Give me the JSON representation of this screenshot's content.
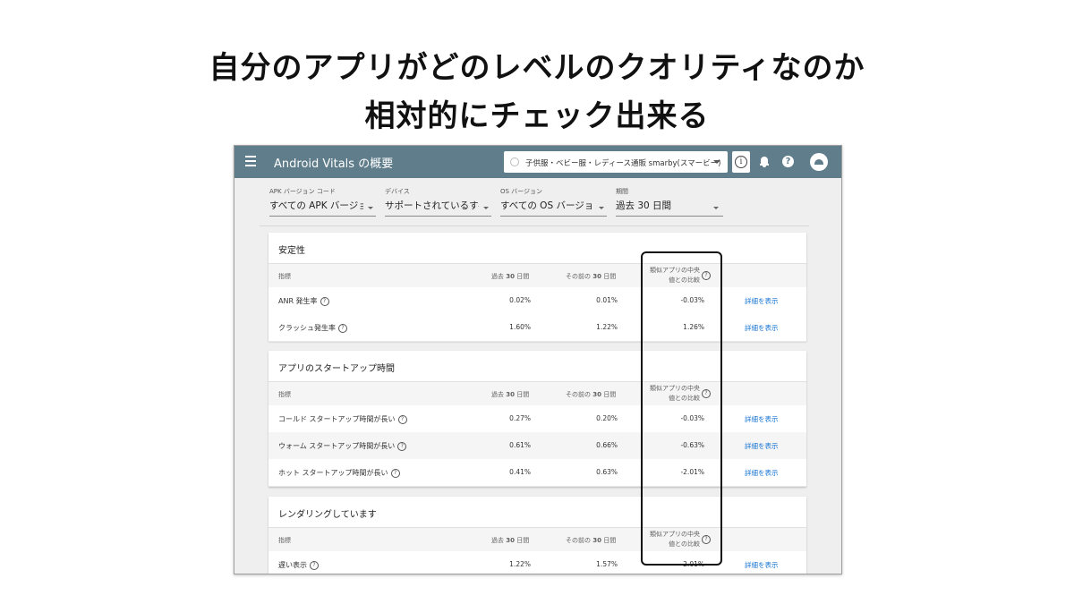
{
  "headline": {
    "line1": "自分のアプリがどのレベルのクオリティなのか",
    "line2": "相対的にチェック出来る"
  },
  "appbar": {
    "title": "Android Vitals の概要",
    "app_selector": "子供服・ベビー服・レディース通販 smarby(スマービー)",
    "info_glyph": "i",
    "help_glyph": "?",
    "colors": {
      "bar": "#607d8b"
    }
  },
  "filters": [
    {
      "label": "APK バージョン コード",
      "value": "すべての APK バージョ"
    },
    {
      "label": "デバイス",
      "value": "サポートされているすべ"
    },
    {
      "label": "OS バージョン",
      "value": "すべての OS バージョン"
    },
    {
      "label": "期間",
      "value": "過去 30 日間"
    }
  ],
  "columns": {
    "metric": "指標",
    "last30_prefix": "過去",
    "last30_num": "30",
    "last30_suffix": "日間",
    "prev30_prefix": "その前の",
    "prev30_num": "30",
    "prev30_suffix": "日間",
    "peer_line1": "類似アプリの中央",
    "peer_line2": "値との比較",
    "help_glyph": "?"
  },
  "sections": [
    {
      "title": "安定性",
      "rows": [
        {
          "metric": "ANR 発生率",
          "last30": "0.02%",
          "prev30": "0.01%",
          "peer": "-0.03%",
          "link": "詳細を表示"
        },
        {
          "metric": "クラッシュ発生率",
          "last30": "1.60%",
          "prev30": "1.22%",
          "peer": "1.26%",
          "link": "詳細を表示"
        }
      ]
    },
    {
      "title": "アプリのスタートアップ時間",
      "rows": [
        {
          "metric": "コールド スタートアップ時間が長い",
          "last30": "0.27%",
          "prev30": "0.20%",
          "peer": "-0.03%",
          "link": "詳細を表示"
        },
        {
          "metric": "ウォーム スタートアップ時間が長い",
          "last30": "0.61%",
          "prev30": "0.66%",
          "peer": "-0.63%",
          "link": "詳細を表示"
        },
        {
          "metric": "ホット スタートアップ時間が長い",
          "last30": "0.41%",
          "prev30": "0.63%",
          "peer": "-2.01%",
          "link": "詳細を表示"
        }
      ]
    },
    {
      "title": "レンダリングしています",
      "rows": [
        {
          "metric": "遅い表示",
          "last30": "1.22%",
          "prev30": "1.57%",
          "peer": "-2.01%",
          "link": "詳細を表示"
        }
      ]
    }
  ]
}
